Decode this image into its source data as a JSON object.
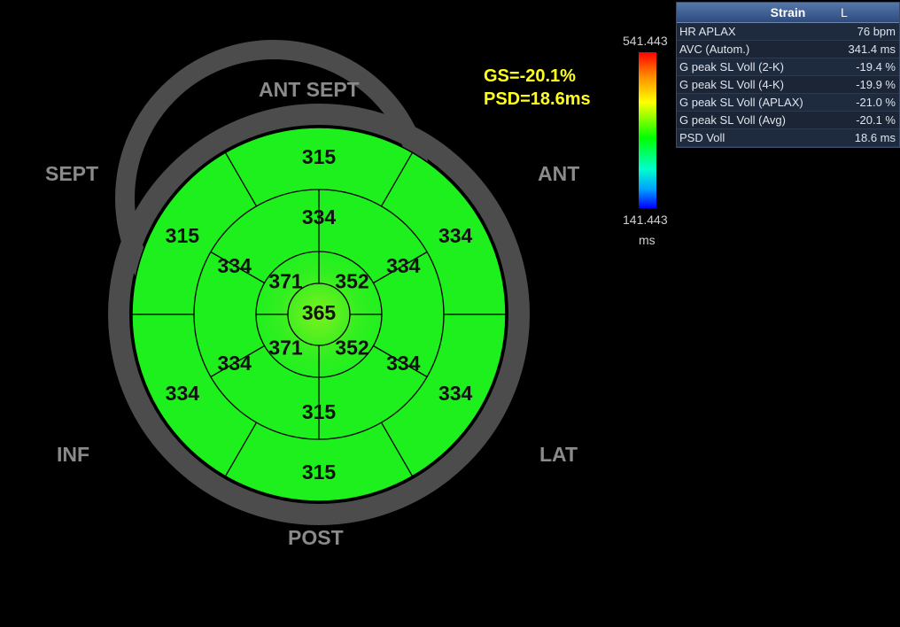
{
  "orientation": {
    "ant_sept": "ANT  SEPT",
    "sept": "SEPT",
    "ant": "ANT",
    "inf": "INF",
    "lat": "LAT",
    "post": "POST"
  },
  "summary": {
    "gs": "GS=-20.1%",
    "psd": "PSD=18.6ms"
  },
  "color_scale": {
    "max": "541.443",
    "min": "141.443",
    "unit": "ms"
  },
  "segments": {
    "basal": [
      "315",
      "334",
      "334",
      "315",
      "334",
      "315"
    ],
    "mid": [
      "334",
      "334",
      "334",
      "315",
      "334",
      "334"
    ],
    "apical": [
      "352",
      "352",
      "371",
      "371"
    ],
    "apex": "365"
  },
  "segment_color": "#1ef01e",
  "panel": {
    "title": "Strain",
    "lead": "L",
    "rows": [
      {
        "label": "HR APLAX",
        "value": "76 bpm"
      },
      {
        "label": "AVC (Autom.)",
        "value": "341.4 ms"
      },
      {
        "label": "G peak SL Voll (2-K)",
        "value": "-19.4 %"
      },
      {
        "label": "G peak SL Voll (4-K)",
        "value": "-19.9 %"
      },
      {
        "label": "G peak SL Voll (APLAX)",
        "value": "-21.0 %"
      },
      {
        "label": "G peak SL Voll (Avg)",
        "value": "-20.1 %"
      },
      {
        "label": "PSD Voll",
        "value": "18.6 ms"
      }
    ]
  }
}
